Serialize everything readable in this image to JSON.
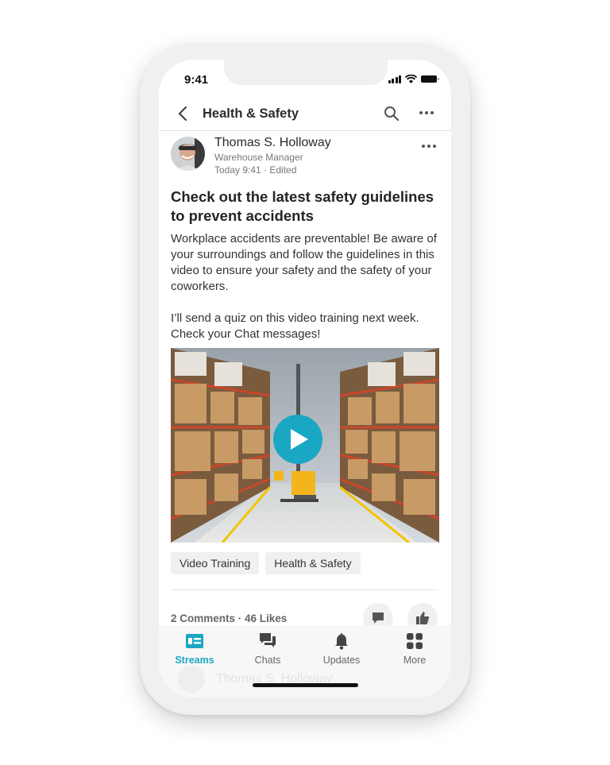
{
  "status_bar": {
    "time": "9:41"
  },
  "nav": {
    "title": "Health & Safety",
    "icons": [
      "back-chevron-icon",
      "search-icon",
      "more-horizontal-icon"
    ]
  },
  "post": {
    "author": "Thomas S. Holloway",
    "role": "Warehouse Manager",
    "timestamp": "Today 9:41 · Edited",
    "title": "Check out the latest safety guidelines to prevent accidents",
    "body": [
      "Workplace accidents are preventable! Be aware of your surroundings and follow the guidelines in this video to ensure your safety and the safety of your coworkers.",
      "I’ll send a quiz on this video training next week. Check your Chat messages!"
    ],
    "media": {
      "type": "video",
      "description": "Warehouse aisle with shelving and forklift",
      "play_icon": "play-icon"
    },
    "tags": [
      "Video Training",
      "Health & Safety"
    ],
    "stats": "2 Comments · 46 Likes"
  },
  "tabbar": {
    "tabs": [
      {
        "label": "Streams",
        "icon": "streams-icon",
        "active": true
      },
      {
        "label": "Chats",
        "icon": "chats-icon",
        "active": false
      },
      {
        "label": "Updates",
        "icon": "bell-icon",
        "active": false
      },
      {
        "label": "More",
        "icon": "grid-icon",
        "active": false
      }
    ],
    "ghost_text": "Thomas S. Holloway"
  },
  "colors": {
    "accent": "#1aa7c4",
    "text": "#242424",
    "muted": "#777777"
  }
}
